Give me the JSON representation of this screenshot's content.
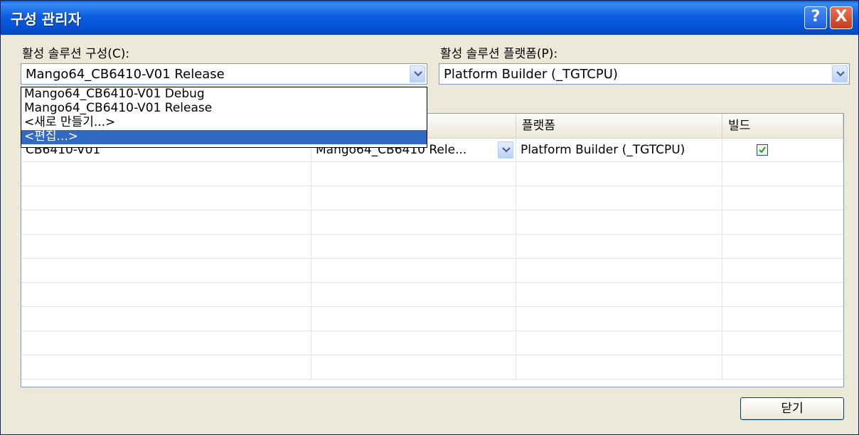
{
  "window": {
    "title": "구성 관리자",
    "help_glyph": "?",
    "close_glyph": "X"
  },
  "active_config": {
    "label": "활성 솔루션 구성(C):",
    "value": "Mango64_CB6410-V01 Release"
  },
  "active_platform": {
    "label": "활성 솔루션 플랫폼(P):",
    "value": "Platform Builder (_TGTCPU)"
  },
  "config_dropdown": {
    "options": [
      "Mango64_CB6410-V01 Debug",
      "Mango64_CB6410-V01 Release",
      "<새로 만들기...>",
      "<편집...>"
    ],
    "selected_index": 3
  },
  "grid": {
    "columns": [
      "",
      "",
      "플랫폼",
      "빌드"
    ],
    "rows": [
      {
        "project": "CB6410-V01",
        "configuration": "Mango64_CB6410 Rele...",
        "platform": "Platform Builder (_TGTCPU)",
        "build": true
      }
    ]
  },
  "buttons": {
    "close_label": "닫기"
  },
  "icons": {
    "dropdown": "chevron-down-icon",
    "check": "check-icon"
  },
  "colors": {
    "title_bar": "#0550d3",
    "selection": "#316ac5",
    "dialog_bg": "#ece9d8"
  }
}
